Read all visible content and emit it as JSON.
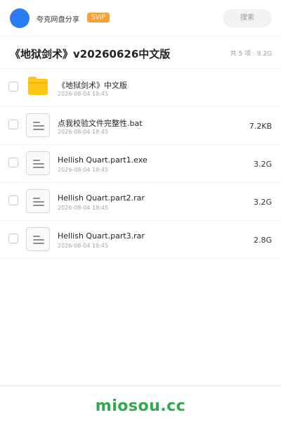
{
  "header": {
    "brand": "夸克网盘分享",
    "badge": "SVIP",
    "search_label": "搜索"
  },
  "share": {
    "title": "《地狱剑术》v20260626中文版",
    "meta": "共 5 项 · 9.2G"
  },
  "files": [
    {
      "icon": "folder-icon",
      "name": "《地狱剑术》中文版",
      "date": "2026-08-04 18:45",
      "size": ""
    },
    {
      "icon": "document-icon",
      "name": "点我校验文件完整性.bat",
      "date": "2026-08-04 18:45",
      "size": "7.2KB"
    },
    {
      "icon": "document-icon",
      "name": "Hellish Quart.part1.exe",
      "date": "2026-08-04 18:45",
      "size": "3.2G"
    },
    {
      "icon": "document-icon",
      "name": "Hellish Quart.part2.rar",
      "date": "2026-08-04 18:45",
      "size": "3.2G"
    },
    {
      "icon": "document-icon",
      "name": "Hellish Quart.part3.rar",
      "date": "2026-08-04 18:45",
      "size": "2.8G"
    }
  ],
  "footer": {
    "watermark": "miosou.cc"
  },
  "colors": {
    "avatar": "#2a7bf6",
    "badge": "#f4a238",
    "folder": "#ffc61a",
    "watermark": "#2fa84f"
  }
}
